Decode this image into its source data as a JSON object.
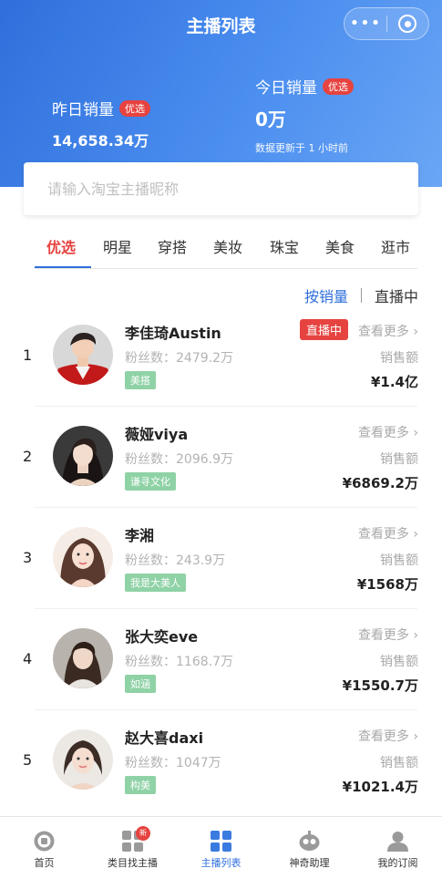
{
  "nav": {
    "title": "主播列表",
    "capsule_more": "•••"
  },
  "stats": {
    "yesterday": {
      "label": "昨日销量",
      "badge": "优选",
      "value": "14,658.34万"
    },
    "today": {
      "label": "今日销量",
      "badge": "优选",
      "value": "0万",
      "note": "数据更新于 1 小时前"
    }
  },
  "search": {
    "placeholder": "请输入淘宝主播昵称"
  },
  "tabs": [
    "优选",
    "明星",
    "穿搭",
    "美妆",
    "珠宝",
    "美食",
    "逛市"
  ],
  "sort": {
    "active": "按销量",
    "other": "直播中"
  },
  "streamers": [
    {
      "rank": "1",
      "name": "李佳琦Austin",
      "fans": "粉丝数：2479.2万",
      "tag": "美搭",
      "live": "直播中",
      "more": "查看更多 ›",
      "sales_label": "销售额",
      "sales": "¥1.4亿"
    },
    {
      "rank": "2",
      "name": "薇娅viya",
      "fans": "粉丝数：2096.9万",
      "tag": "谦寻文化",
      "more": "查看更多 ›",
      "sales_label": "销售额",
      "sales": "¥6869.2万"
    },
    {
      "rank": "3",
      "name": "李湘",
      "fans": "粉丝数：243.9万",
      "tag": "我是大美人",
      "more": "查看更多 ›",
      "sales_label": "销售额",
      "sales": "¥1568万"
    },
    {
      "rank": "4",
      "name": "张大奕eve",
      "fans": "粉丝数：1168.7万",
      "tag": "如涵",
      "more": "查看更多 ›",
      "sales_label": "销售额",
      "sales": "¥1550.7万"
    },
    {
      "rank": "5",
      "name": "赵大喜daxi",
      "fans": "粉丝数：1047万",
      "tag": "构美",
      "more": "查看更多 ›",
      "sales_label": "销售额",
      "sales": "¥1021.4万"
    }
  ],
  "tabbar": [
    {
      "label": "首页",
      "icon": "home-icon"
    },
    {
      "label": "类目找主播",
      "icon": "category-icon",
      "badge": "新"
    },
    {
      "label": "主播列表",
      "icon": "grid-list-icon",
      "active": true
    },
    {
      "label": "神奇助理",
      "icon": "robot-icon"
    },
    {
      "label": "我的订阅",
      "icon": "user-icon"
    }
  ],
  "colors": {
    "brand_blue": "#2f6fdc",
    "badge_red": "#e64340",
    "tag_green": "#8fd2a6"
  }
}
